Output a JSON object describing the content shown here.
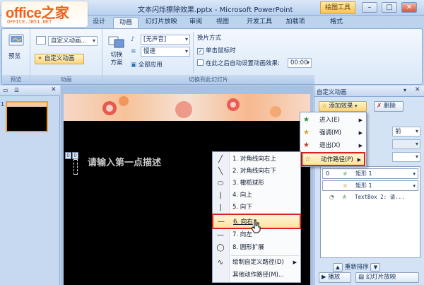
{
  "logo": {
    "main": "office之家",
    "sub": "OFFICE.JB51.NET"
  },
  "window": {
    "title": "文本闪烁擦除效果.pptx - Microsoft PowerPoint",
    "context_tab": "绘图工具"
  },
  "tabs": [
    {
      "label": "设计"
    },
    {
      "label": "动画"
    },
    {
      "label": "幻灯片放映"
    },
    {
      "label": "审阅"
    },
    {
      "label": "视图"
    },
    {
      "label": "开发工具"
    },
    {
      "label": "加载项"
    },
    {
      "label": "格式"
    }
  ],
  "ribbon": {
    "preview": {
      "button": "预览",
      "group": "预览"
    },
    "animation": {
      "dropdown": "自定义动画...",
      "custom_button": "自定义动画",
      "group": "动画"
    },
    "transition": {
      "switch_button": "切换\n方案",
      "sound": "[无声音]",
      "speed": "慢速",
      "apply_all": "全部应用",
      "advance_heading": "换片方式",
      "on_click": "单击鼠标时",
      "after_label": "在此之后自动设置动画效果:",
      "after_time": "00:00",
      "group": "切换到此幻灯片"
    }
  },
  "slide": {
    "placeholder": "请输入第一点描述",
    "markers": [
      "0",
      "0"
    ],
    "thumb_number": "1"
  },
  "path_menu": {
    "items": [
      {
        "icon": "diagonal-up-right-icon",
        "glyph": "╱",
        "label": "1. 对角线向右上"
      },
      {
        "icon": "diagonal-down-right-icon",
        "glyph": "╲",
        "label": "2. 对角线向右下"
      },
      {
        "icon": "ellipse-icon",
        "glyph": "⬭",
        "label": "3. 橄榄球形"
      },
      {
        "icon": "line-up-icon",
        "glyph": "|",
        "label": "4. 向上"
      },
      {
        "icon": "line-down-icon",
        "glyph": "|",
        "label": "5. 向下"
      },
      {
        "icon": "line-right-icon",
        "glyph": "—",
        "label": "6. 向右"
      },
      {
        "icon": "line-left-icon",
        "glyph": "—",
        "label": "7. 向左"
      },
      {
        "icon": "circle-icon",
        "glyph": "◯",
        "label": "8. 圆形扩展"
      },
      {
        "icon": "freeform-path-icon",
        "glyph": "∿",
        "label": "绘制自定义路径(D)"
      },
      {
        "icon": "",
        "glyph": "",
        "label": "其他动作路径(M)..."
      }
    ]
  },
  "task_pane": {
    "title": "自定义动画",
    "add_effect": "添加效果",
    "remove": "删除",
    "start_value": "前",
    "effects": [
      {
        "num": "0",
        "name": "矩形 1"
      },
      {
        "num": "",
        "name": "矩形 1"
      },
      {
        "num": "",
        "name": "TextBox 2: 请..."
      }
    ],
    "reorder": "重新排序",
    "play": "播放",
    "slideshow": "幻灯片放映"
  },
  "add_menu": {
    "items": [
      {
        "label": "进入(E)"
      },
      {
        "label": "强调(M)"
      },
      {
        "label": "退出(X)"
      },
      {
        "label": "动作路径(P)"
      }
    ]
  },
  "colors": {
    "highlight_box": "#dd2222",
    "accent_orange": "#e8641b",
    "ribbon_blue": "#bcd3ee"
  }
}
